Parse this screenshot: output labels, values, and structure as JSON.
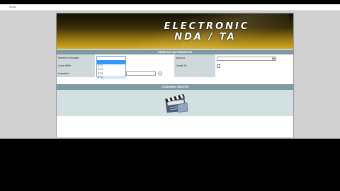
{
  "browser": {
    "tab_label": "home"
  },
  "banner": {
    "line1": "ELECTRONIC",
    "line2": "NDA / TA"
  },
  "general_information": {
    "header": "GENERAL INFORMATION",
    "labels": {
      "reference_number": "Reference Number",
      "cover_mbh": "Cover MBH",
      "inspection": "Inspection",
      "sponsor": "Sponsor",
      "create_ta": "Create TA"
    },
    "list_options": [
      "",
      "",
      "ST 1",
      "ST 2",
      "ST 3",
      "ST 4",
      "ST 5"
    ],
    "selected_index": 1,
    "hover_index": 5,
    "sponsor_value": ""
  },
  "learning_center": {
    "header": "LEARNING CENTER",
    "icon": "clapperboard-icon"
  },
  "colors": {
    "section_header": "#7f9aa4",
    "label_bg": "#cfd9db",
    "learning_bg": "#d2e0e2",
    "banner_gold": "#d4aa22"
  }
}
